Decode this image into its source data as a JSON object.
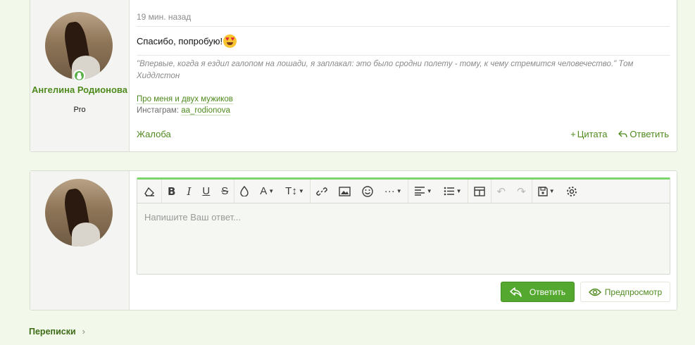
{
  "post": {
    "time": "19 мин. назад",
    "message": "Спасибо, попробую!",
    "emoji": "heart-eyes-emoji",
    "signature_quote": "\"Впервые, когда я ездил галопом на лошади, я заплакал: это было сродни полету - тому, к чему стремится человечество.\" Том Хиддлстон",
    "signature_link": "Про меня и двух мужиков",
    "instagram_label": "Инстаграм:",
    "instagram_handle": "aa_rodionova",
    "report_label": "Жалоба",
    "quote_label": "Цитата",
    "reply_label": "Ответить"
  },
  "user": {
    "name": "Ангелина Родионова",
    "title": "Pro"
  },
  "editor": {
    "placeholder": "Напишите Ваш ответ...",
    "toolbar": [
      "eraser-icon",
      "bold-icon",
      "italic-icon",
      "underline-icon",
      "strikethrough-icon",
      "color-drop-icon",
      "font-family-icon",
      "font-size-icon",
      "link-icon",
      "image-icon",
      "smiley-icon",
      "more-icon",
      "align-icon",
      "list-icon",
      "table-icon",
      "undo-icon",
      "redo-icon",
      "save-draft-icon",
      "settings-icon"
    ],
    "reply_button": "Ответить",
    "preview_button": "Предпросмотр"
  },
  "breadcrumb": {
    "label": "Переписки"
  },
  "colors": {
    "accent": "#4f8a1e",
    "button": "#55a82f",
    "editor_top": "#7ad66a",
    "background": "#f2f8ea"
  }
}
